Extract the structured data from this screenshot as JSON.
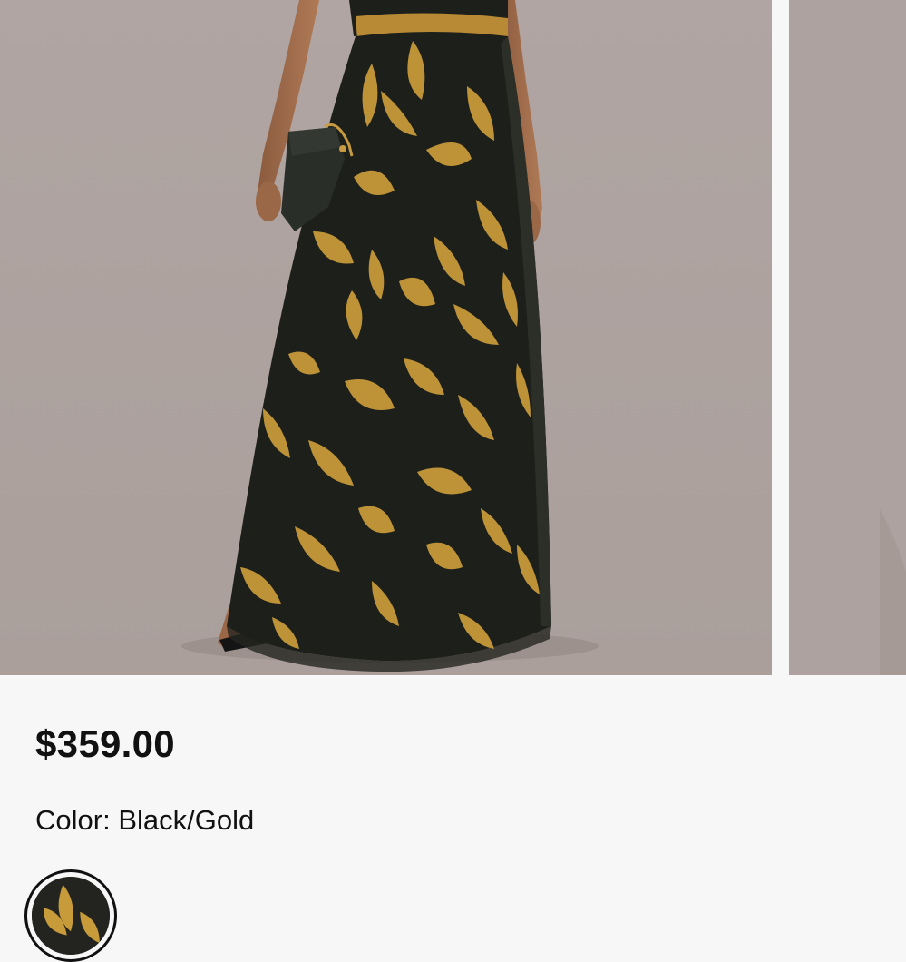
{
  "product": {
    "price": "$359.00",
    "color_label": "Color:",
    "color_value": "Black/Gold"
  },
  "gallery": {
    "images": [
      {
        "alt": "Model wearing black gown with gold feather embroidery, holding a dark clutch"
      },
      {
        "alt": "Next product image"
      }
    ],
    "background_color": "#ada29f"
  },
  "swatches": [
    {
      "name": "Black/Gold",
      "selected": true
    }
  ],
  "colors": {
    "accent_gold": "#c79a3a",
    "dress_black": "#1d1f1a"
  }
}
